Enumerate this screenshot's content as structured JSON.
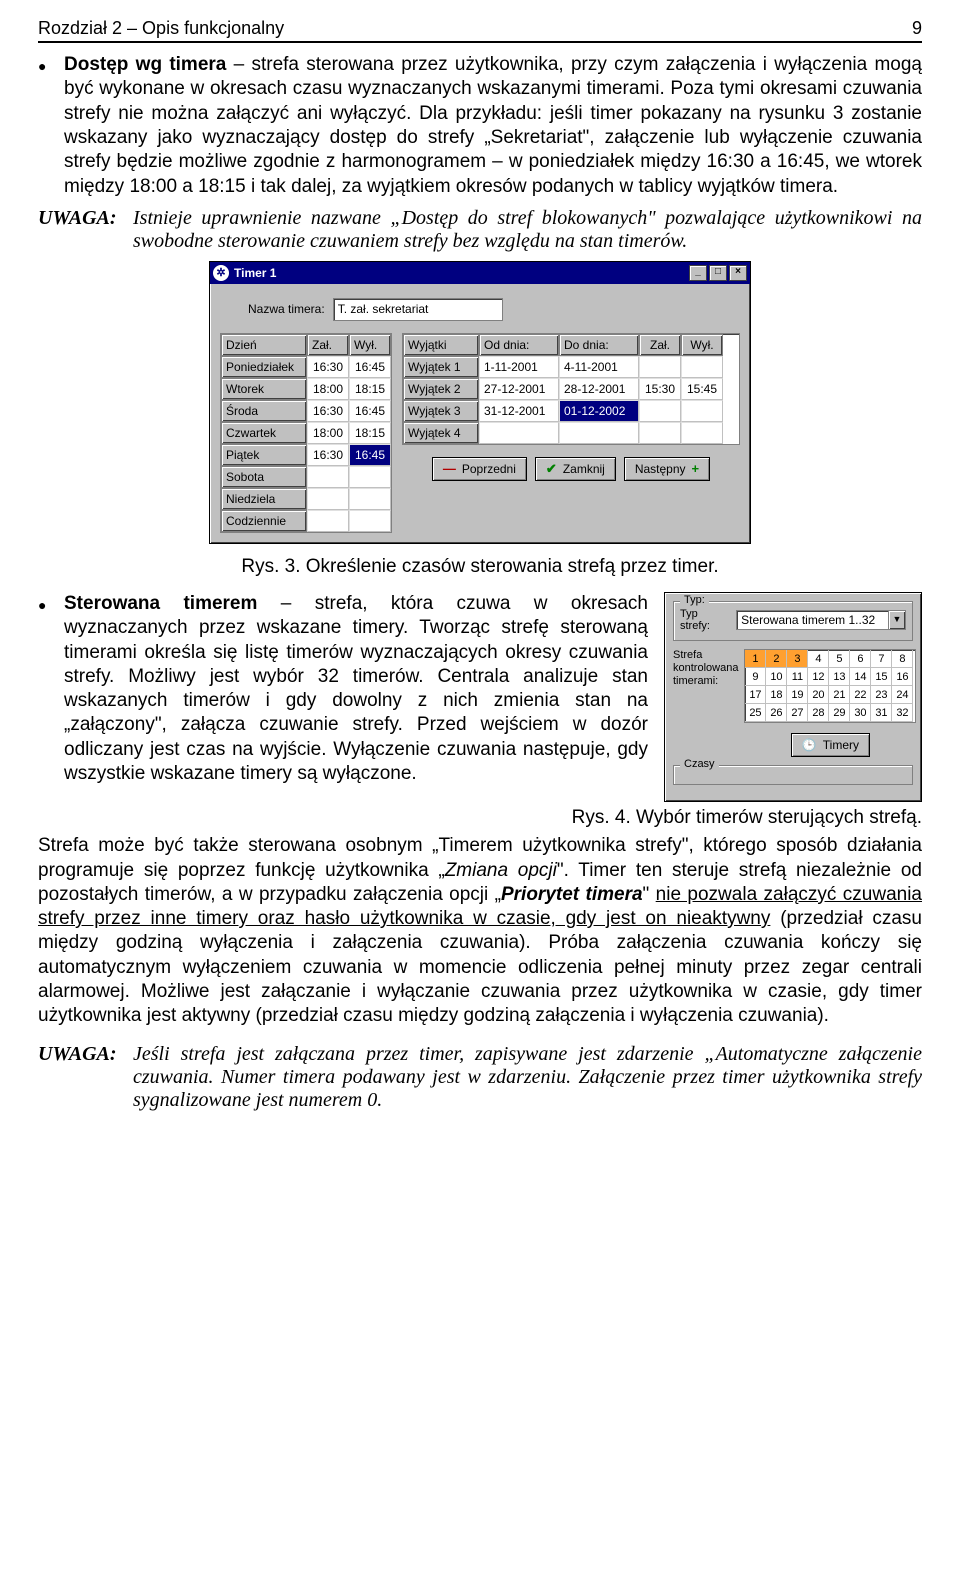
{
  "header": {
    "left": "Rozdział 2 – Opis funkcjonalny",
    "right": "9"
  },
  "para1": {
    "bullet_title": "Dostęp wg timera",
    "bullet_rest": " – strefa sterowana przez użytkownika, przy czym załączenia i wyłączenia mogą być wykonane w okresach czasu wyznaczanych wskazanymi timerami. Poza tymi okresami czuwania strefy nie można załączyć ani wyłączyć. Dla przykładu: jeśli timer pokazany na rysunku 3 zostanie wskazany jako wyznaczający dostęp do strefy „Sekretariat\", załączenie lub wyłączenie czuwania strefy będzie możliwe zgodnie z harmonogramem – w poniedziałek między 16:30 a 16:45, we wtorek między 18:00 a 18:15 i tak dalej, za wyjątkiem okresów podanych w tablicy wyjątków timera."
  },
  "note1": {
    "label": "UWAGA:",
    "text": "Istnieje uprawnienie nazwane „Dostęp do stref blokowanych\" pozwalające użytkownikowi na swobodne sterowanie czuwaniem strefy bez względu na stan timerów."
  },
  "timer_window": {
    "title": "Timer 1",
    "name_label": "Nazwa timera:",
    "name_value": "T. zał. sekretariat",
    "left_headers": [
      "Dzień",
      "Zał.",
      "Wył."
    ],
    "days": [
      {
        "name": "Poniedziałek",
        "on": "16:30",
        "off": "16:45"
      },
      {
        "name": "Wtorek",
        "on": "18:00",
        "off": "18:15"
      },
      {
        "name": "Środa",
        "on": "16:30",
        "off": "16:45"
      },
      {
        "name": "Czwartek",
        "on": "18:00",
        "off": "18:15"
      },
      {
        "name": "Piątek",
        "on": "16:30",
        "off": "16:45"
      },
      {
        "name": "Sobota",
        "on": "",
        "off": ""
      },
      {
        "name": "Niedziela",
        "on": "",
        "off": ""
      },
      {
        "name": "Codziennie",
        "on": "",
        "off": ""
      }
    ],
    "right_headers": [
      "Wyjątki",
      "Od dnia:",
      "Do dnia:",
      "Zał.",
      "Wył."
    ],
    "exceptions": [
      {
        "name": "Wyjątek 1",
        "from": "1-11-2001",
        "to": "4-11-2001",
        "on": "",
        "off": ""
      },
      {
        "name": "Wyjątek 2",
        "from": "27-12-2001",
        "to": "28-12-2001",
        "on": "15:30",
        "off": "15:45"
      },
      {
        "name": "Wyjątek 3",
        "from": "31-12-2001",
        "to": "01-12-2002",
        "on": "",
        "off": "",
        "to_selected": true
      },
      {
        "name": "Wyjątek 4",
        "from": "",
        "to": "",
        "on": "",
        "off": ""
      }
    ],
    "btn_prev": "Poprzedni",
    "btn_close": "Zamknij",
    "btn_next": "Następny"
  },
  "figcap1": "Rys. 3. Określenie czasów sterowania strefą przez timer.",
  "para2": {
    "bullet_title": "Sterowana timerem",
    "bullet_rest": " – strefa, która czuwa w okresach wyznaczanych przez wskazane timery. Tworząc strefę sterowaną timerami określa się listę timerów wyznaczających okresy czuwania strefy. Możliwy jest wybór 32 timerów. Centrala analizuje stan wskazanych timerów i gdy dowolny z nich zmienia stan na „załączony\", załącza czuwanie strefy. Przed wejściem w dozór odliczany jest czas na wyjście. Wyłączenie czuwania następuje, gdy wszystkie wskazane timery są wyłączone."
  },
  "panel2": {
    "typ_label": "Typ:",
    "typ_strefy_label": "Typ strefy:",
    "combo_value": "Sterowana timerem 1..32",
    "group_label": "Strefa kontrolowana timerami:",
    "grid": [
      [
        1,
        2,
        3,
        4,
        5,
        6,
        7,
        8
      ],
      [
        9,
        10,
        11,
        12,
        13,
        14,
        15,
        16
      ],
      [
        17,
        18,
        19,
        20,
        21,
        22,
        23,
        24
      ],
      [
        25,
        26,
        27,
        28,
        29,
        30,
        31,
        32
      ]
    ],
    "selected": [
      1,
      2,
      3
    ],
    "timery_btn": "Timery",
    "czasy_label": "Czasy"
  },
  "figcap2": "Rys. 4. Wybór timerów sterujących strefą.",
  "para3_a": "Strefa może być także sterowana osobnym „Timerem użytkownika strefy\", którego sposób działania programuje się poprzez funkcję użytkownika „",
  "para3_b_italic": "Zmiana opcji",
  "para3_c": "\". Timer ten steruje strefą niezależnie od pozostałych timerów, a w przypadku załączenia opcji „",
  "para3_d_bold": "Priorytet timera",
  "para3_e": "\" ",
  "para3_f_u": "nie pozwala załączyć czuwania strefy przez inne timery oraz hasło użytkownika w czasie, gdy jest on nieaktywny",
  "para3_g": " (przedział czasu między godziną wyłączenia i załączenia czuwania). Próba załączenia czuwania kończy się automatycznym wyłączeniem czuwania w momencie odliczenia pełnej minuty przez zegar centrali alarmowej. Możliwe jest załączanie i wyłączanie czuwania przez użytkownika w czasie, gdy timer użytkownika jest aktywny (przedział czasu między godziną załączenia i wyłączenia czuwania).",
  "note2": {
    "label": "UWAGA:",
    "text": "Jeśli strefa jest załączana przez timer, zapisywane jest zdarzenie „Automatyczne załączenie czuwania. Numer timera podawany jest w zdarzeniu. Załączenie przez timer użytkownika strefy sygnalizowane jest numerem 0."
  }
}
